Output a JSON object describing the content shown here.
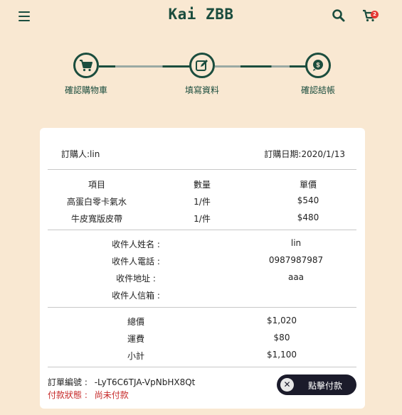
{
  "header": {
    "brand": "Kai ZBB",
    "cart_count": "2"
  },
  "steps": [
    {
      "label": "確認購物車",
      "icon": "cart-icon"
    },
    {
      "label": "填寫資料",
      "icon": "edit-icon"
    },
    {
      "label": "確認結帳",
      "icon": "money-icon"
    }
  ],
  "order": {
    "buyer_label": "訂購人:",
    "buyer": "lin",
    "date_label": "訂購日期:",
    "date": "2020/1/13",
    "columns": [
      "項目",
      "數量",
      "單價"
    ],
    "items": [
      {
        "name": "高蛋白零卡氣水",
        "qty": "1/件",
        "price": "$540"
      },
      {
        "name": "牛皮寬版皮帶",
        "qty": "1/件",
        "price": "$480"
      }
    ],
    "recipient": [
      {
        "label": "收件人姓名 :",
        "value": "lin"
      },
      {
        "label": "收件人電話 :",
        "value": "0987987987"
      },
      {
        "label": "收件地址 :",
        "value": "aaa"
      },
      {
        "label": "收件人信箱 :",
        "value": ""
      }
    ],
    "totals": [
      {
        "label": "總價",
        "value": "$1,020"
      },
      {
        "label": "運費",
        "value": "$80"
      },
      {
        "label": "小計",
        "value": "$1,100"
      }
    ],
    "order_no_label": "訂單編號 :",
    "order_no": "-LyT6C6TJA-VpNbHX8Qt",
    "status_label": "付款狀態 :",
    "status": "尚未付款",
    "pay_button": "點擊付款"
  },
  "colors": {
    "background": "#f9e8d2",
    "primary": "#1b4d3e",
    "badge": "#e53935",
    "status_text": "#c62828",
    "pay_button": "#1b1b2b"
  }
}
